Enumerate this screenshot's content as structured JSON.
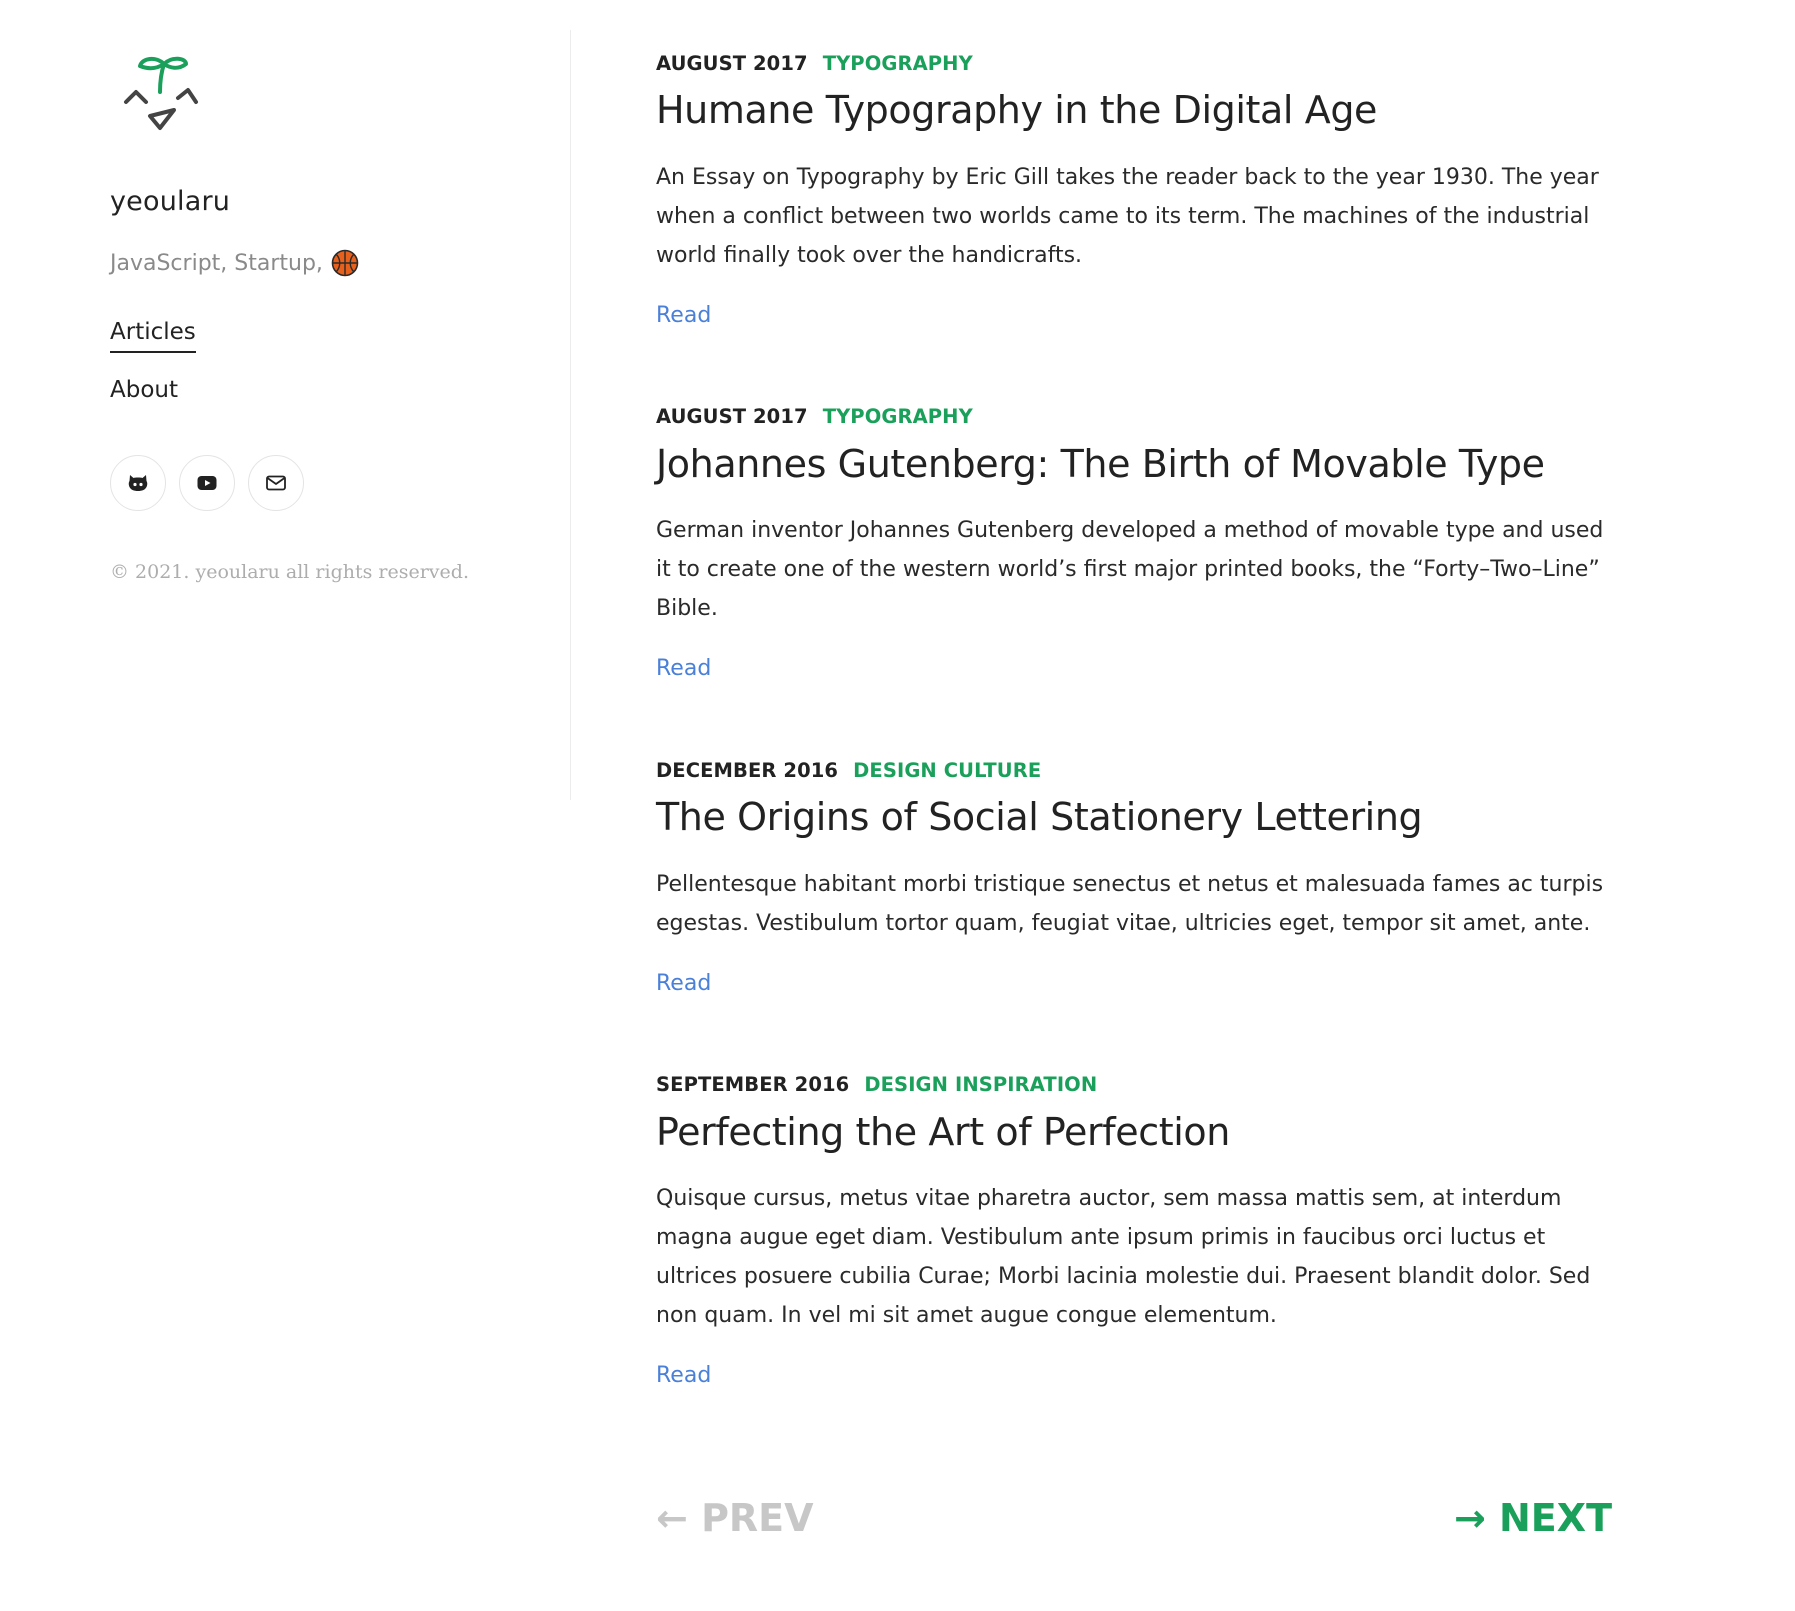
{
  "sidebar": {
    "site_title": "yeoularu",
    "tagline": "JavaScript, Startup,",
    "tagline_icon": "basketball-icon",
    "nav": [
      {
        "label": "Articles",
        "active": true
      },
      {
        "label": "About",
        "active": false
      }
    ],
    "social": [
      {
        "icon": "github-icon"
      },
      {
        "icon": "youtube-icon"
      },
      {
        "icon": "mail-icon"
      }
    ],
    "copyright": "© 2021. yeoularu all rights reserved."
  },
  "posts": [
    {
      "date": "AUGUST 2017",
      "category": "TYPOGRAPHY",
      "title": "Humane Typography in the Digital Age",
      "excerpt": "An Essay on Typography by Eric Gill takes the reader back to the year 1930. The year when a conflict between two worlds came to its term. The machines of the industrial world finally took over the handicrafts.",
      "read_label": "Read"
    },
    {
      "date": "AUGUST 2017",
      "category": "TYPOGRAPHY",
      "title": "Johannes Gutenberg: The Birth of Movable Type",
      "excerpt": "German inventor Johannes Gutenberg developed a method of movable type and used it to create one of the western world’s first major printed books, the “Forty–Two–Line” Bible.",
      "read_label": "Read"
    },
    {
      "date": "DECEMBER 2016",
      "category": "DESIGN CULTURE",
      "title": "The Origins of Social Stationery Lettering",
      "excerpt": "Pellentesque habitant morbi tristique senectus et netus et malesuada fames ac turpis egestas. Vestibulum tortor quam, feugiat vitae, ultricies eget, tempor sit amet, ante.",
      "read_label": "Read"
    },
    {
      "date": "SEPTEMBER 2016",
      "category": "DESIGN INSPIRATION",
      "title": "Perfecting the Art of Perfection",
      "excerpt": "Quisque cursus, metus vitae pharetra auctor, sem massa mattis sem, at interdum magna augue eget diam. Vestibulum ante ipsum primis in faucibus orci luctus et ultrices posuere cubilia Curae; Morbi lacinia molestie dui. Praesent blandit dolor. Sed non quam. In vel mi sit amet augue congue elementum.",
      "read_label": "Read"
    }
  ],
  "pagination": {
    "prev_label": "← PREV",
    "next_label": "→ NEXT"
  },
  "colors": {
    "accent_green": "#1aa05a",
    "link_blue": "#4a80d8",
    "muted_gray": "#c7c7c7"
  }
}
